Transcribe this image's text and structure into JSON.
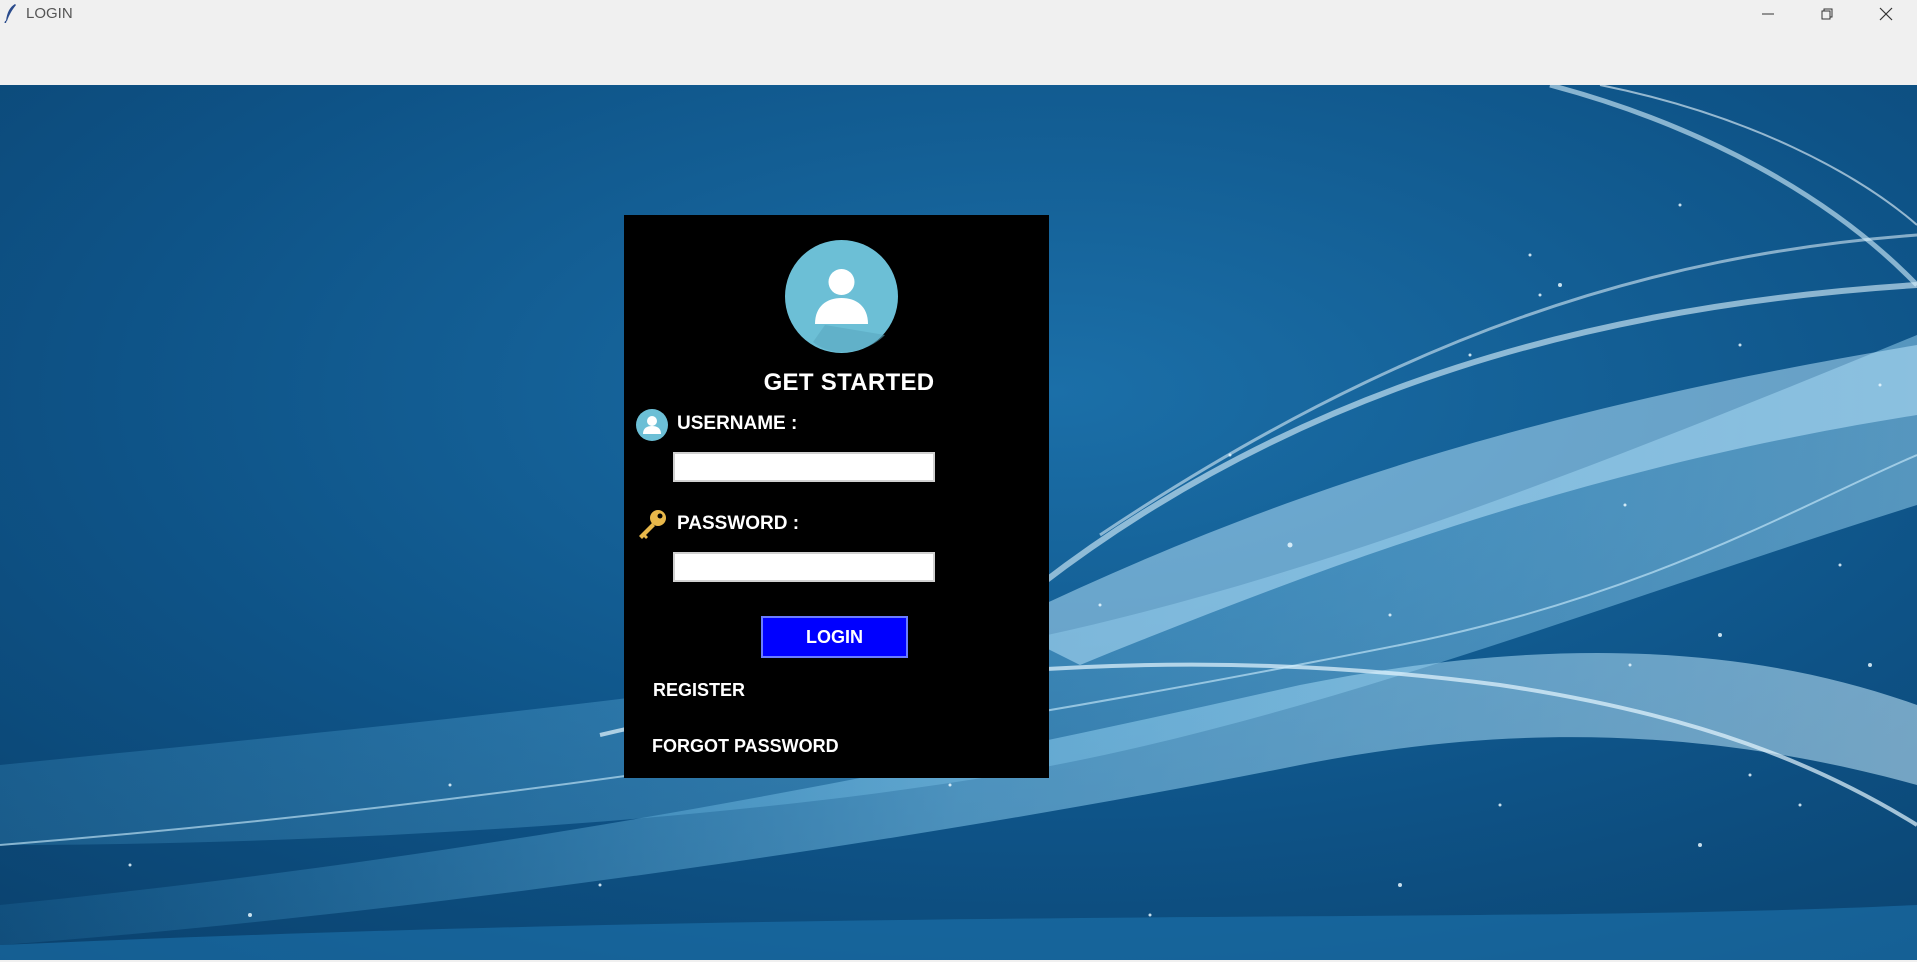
{
  "window": {
    "title": "LOGIN",
    "app_icon": "feather-icon",
    "controls": [
      "minimize-icon",
      "restore-icon",
      "close-icon"
    ]
  },
  "login": {
    "heading": "GET STARTED",
    "username_label": "USERNAME :",
    "username_value": "",
    "username_icon": "user-icon",
    "password_label": "PASSWORD :",
    "password_value": "",
    "password_icon": "key-icon",
    "login_button": "LOGIN",
    "register_link": "REGISTER",
    "forgot_link": "FORGOT PASSWORD",
    "avatar_icon": "user-avatar-icon"
  },
  "colors": {
    "panel": "#000000",
    "button": "#0000ff",
    "avatar": "#6cbfd6",
    "background": "#0b4d7f",
    "key": "#e8b84a"
  }
}
